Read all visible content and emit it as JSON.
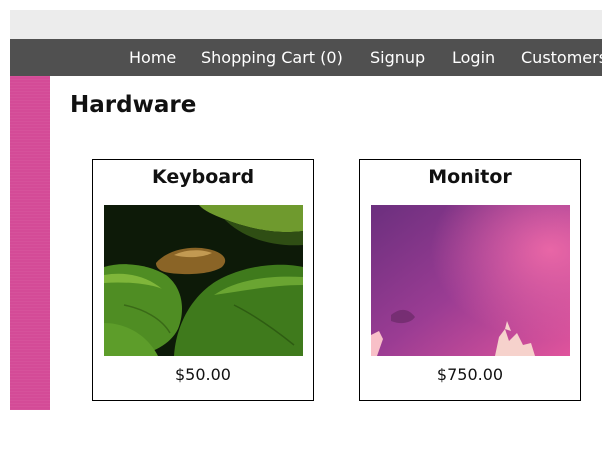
{
  "nav": {
    "items": [
      {
        "label": "Home"
      },
      {
        "label": "Shopping Cart (0)"
      },
      {
        "label": "Signup"
      },
      {
        "label": "Login"
      },
      {
        "label": "Customers"
      }
    ]
  },
  "main": {
    "title": "Hardware",
    "products": [
      {
        "name": "Keyboard",
        "price": "$50.00"
      },
      {
        "name": "Monitor",
        "price": "$750.00"
      }
    ]
  },
  "colors": {
    "navbar": "#505050",
    "sidebar": "#d44b97",
    "top_strip": "#ececec"
  }
}
